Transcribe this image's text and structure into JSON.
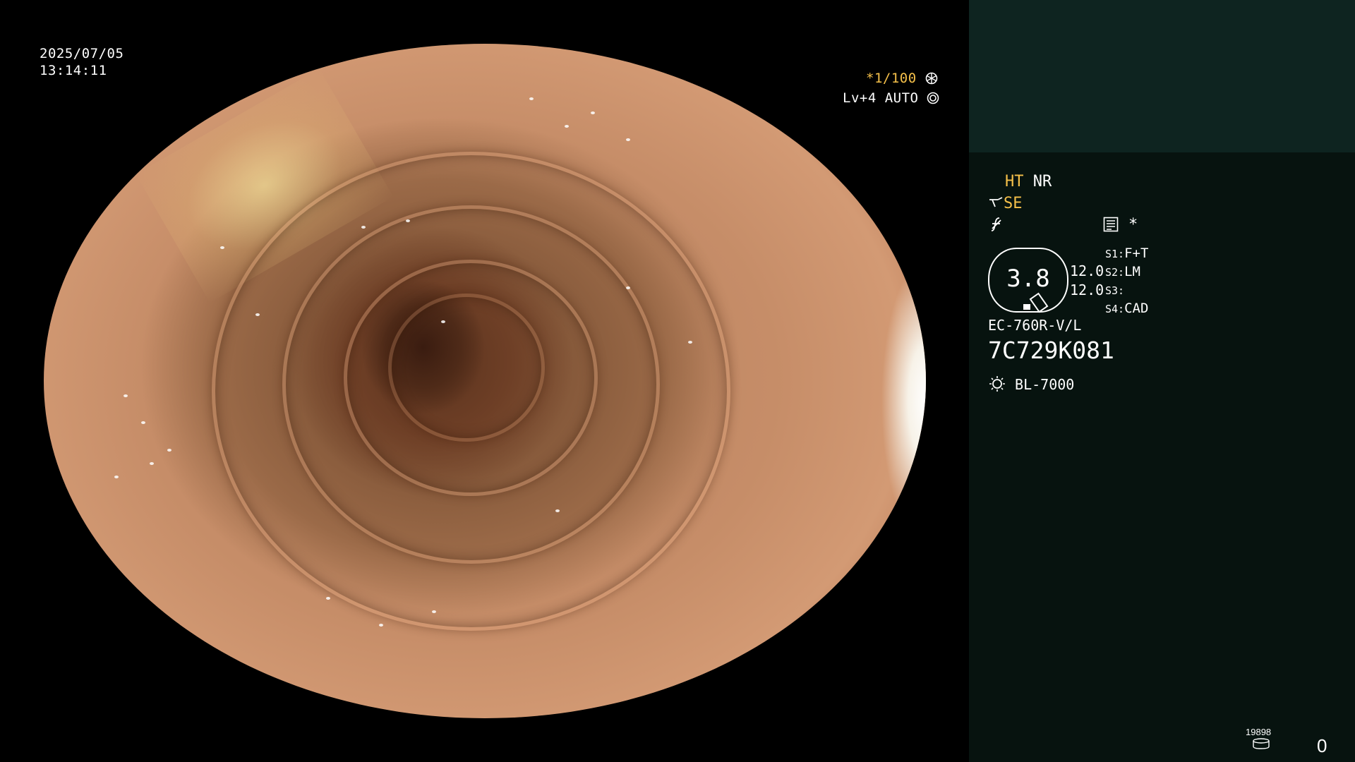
{
  "overlay": {
    "date": "2025/07/05",
    "time": "13:14:11",
    "shutter": "*1/100",
    "shutter_icon": "aperture-icon",
    "level": "Lv+4 AUTO",
    "level_icon": "target-icon"
  },
  "panel": {
    "mode_ht": "HT",
    "mode_nr": "NR",
    "mode_se": "SE",
    "se_icon": "scope-icon",
    "f_icon": "crossed-f-icon",
    "memo_icon": "list-icon",
    "asterisk": "*",
    "gauge_value": "3.8",
    "val1": "12.0",
    "val2": "12.0",
    "s1_label": "S1:",
    "s1_value": "F+T",
    "s2_label": "S2:",
    "s2_value": "LM",
    "s3_label": "S3:",
    "s3_value": "",
    "s4_label": "S4:",
    "s4_value": "CAD",
    "scope_model": "EC-760R-V/L",
    "serial": "7C729K081",
    "light_source_icon": "sun-icon",
    "light_source": "BL-7000",
    "counter_small": "19898",
    "counter_icon": "storage-icon",
    "counter_value": "0"
  },
  "colors": {
    "accent_yellow": "#f5c04a",
    "panel_bg": "#07130f",
    "panel_top_bg": "#0e2420"
  }
}
